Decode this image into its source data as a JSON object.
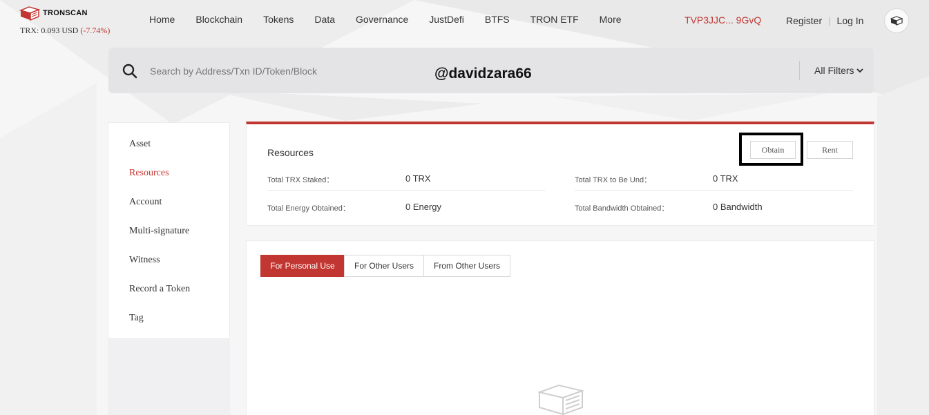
{
  "brand": {
    "name": "TRONSCAN"
  },
  "price": {
    "text": "TRX: 0.093 USD ",
    "change": "(-7.74%)"
  },
  "nav": {
    "items": [
      "Home",
      "Blockchain",
      "Tokens",
      "Data",
      "Governance",
      "JustDefi",
      "BTFS",
      "TRON ETF",
      "More"
    ]
  },
  "wallet": {
    "address": "TVP3JJC... 9GvQ"
  },
  "auth": {
    "register": "Register",
    "separator": "|",
    "login": "Log In"
  },
  "search": {
    "placeholder": "Search by Address/Txn ID/Token/Block",
    "filters_label": "All Filters"
  },
  "watermark": "@davidzara66",
  "sidebar": {
    "items": [
      {
        "label": "Asset",
        "active": false
      },
      {
        "label": "Resources",
        "active": true
      },
      {
        "label": "Account",
        "active": false
      },
      {
        "label": "Multi-signature",
        "active": false
      },
      {
        "label": "Witness",
        "active": false
      },
      {
        "label": "Record a Token",
        "active": false
      },
      {
        "label": "Tag",
        "active": false
      }
    ]
  },
  "resources": {
    "title": "Resources",
    "obtain_label": "Obtain",
    "rent_label": "Rent",
    "stats": [
      {
        "label": "Total TRX Staked：",
        "value": "0 TRX"
      },
      {
        "label": "Total TRX to Be Und：",
        "value": "0 TRX"
      },
      {
        "label": "Total Energy Obtained：",
        "value": "0 Energy"
      },
      {
        "label": "Total Bandwidth Obtained：",
        "value": "0 Bandwidth"
      }
    ]
  },
  "tabs": [
    {
      "label": "For Personal Use",
      "active": true
    },
    {
      "label": "For Other Users",
      "active": false
    },
    {
      "label": "From Other Users",
      "active": false
    }
  ],
  "colors": {
    "accent": "#c23631",
    "search_bg": "#e4e4e6"
  },
  "icons": [
    "tronscan-logo-icon",
    "search-icon",
    "chevron-down-icon",
    "language-icon",
    "empty-box-icon"
  ]
}
